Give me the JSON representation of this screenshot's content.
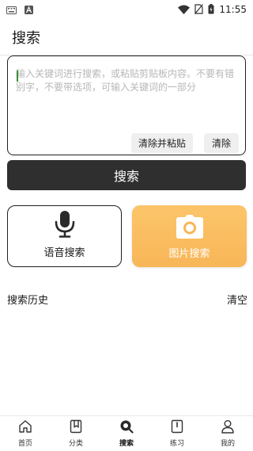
{
  "status_bar": {
    "time": "11:55",
    "left_icons": [
      "keyboard-icon",
      "notification-a-icon"
    ],
    "right_icons": [
      "wifi-icon",
      "no-sim-icon",
      "battery-charging-icon"
    ]
  },
  "header": {
    "title": "搜索"
  },
  "search": {
    "placeholder": "输入关键词进行搜索，或粘贴剪贴板内容。不要有错别字，不要带选项，可输入关键词的一部分",
    "value": "",
    "clear_paste_label": "清除并粘贴",
    "clear_label": "清除",
    "button_label": "搜索"
  },
  "cards": {
    "voice": {
      "label": "语音搜索",
      "icon": "microphone-icon"
    },
    "image": {
      "label": "图片搜索",
      "icon": "camera-icon"
    }
  },
  "history": {
    "title": "搜索历史",
    "clear_label": "清空"
  },
  "nav": {
    "items": [
      {
        "label": "首页",
        "icon": "home-icon"
      },
      {
        "label": "分类",
        "icon": "bookmark-icon"
      },
      {
        "label": "搜索",
        "icon": "search-icon",
        "active": true
      },
      {
        "label": "练习",
        "icon": "book-icon"
      },
      {
        "label": "我的",
        "icon": "profile-icon"
      }
    ]
  },
  "colors": {
    "accent_orange": "#f8b658",
    "dark_button": "#2f2f2f",
    "caret_green": "#3a8f3a"
  }
}
